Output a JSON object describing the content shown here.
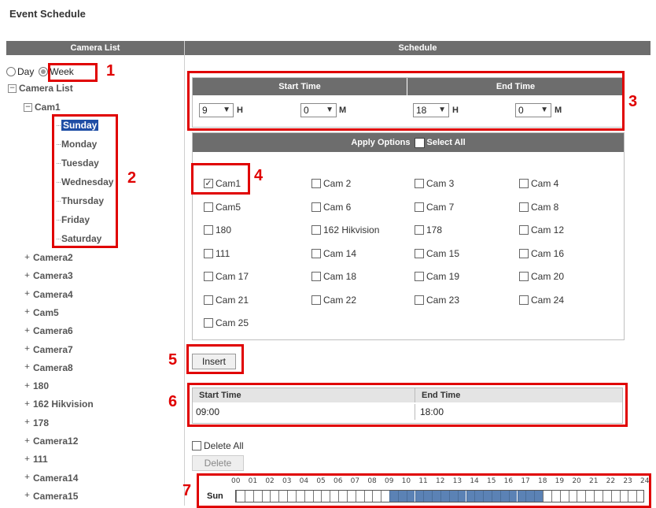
{
  "page_title": "Event Schedule",
  "left": {
    "header": "Camera List",
    "mode_day": "Day",
    "mode_week": "Week",
    "root": "Camera List",
    "cam1": "Cam1",
    "days": [
      "Sunday",
      "Monday",
      "Tuesday",
      "Wednesday",
      "Thursday",
      "Friday",
      "Saturday"
    ],
    "selected_day": "Sunday",
    "cameras": [
      "Camera2",
      "Camera3",
      "Camera4",
      "Cam5",
      "Camera6",
      "Camera7",
      "Camera8",
      "180",
      "162 Hikvision",
      "178",
      "Camera12",
      "111",
      "Camera14",
      "Camera15"
    ]
  },
  "schedule": {
    "header": "Schedule",
    "start_time_label": "Start Time",
    "end_time_label": "End Time",
    "start_hour": "9",
    "start_min": "0",
    "end_hour": "18",
    "end_min": "0",
    "unit_h": "H",
    "unit_m": "M",
    "apply_options": "Apply Options",
    "select_all": "Select All",
    "cams": [
      {
        "label": "Cam1",
        "checked": true
      },
      {
        "label": "Cam 2",
        "checked": false
      },
      {
        "label": "Cam 3",
        "checked": false
      },
      {
        "label": "Cam 4",
        "checked": false
      },
      {
        "label": "Cam5",
        "checked": false
      },
      {
        "label": "Cam 6",
        "checked": false
      },
      {
        "label": "Cam 7",
        "checked": false
      },
      {
        "label": "Cam 8",
        "checked": false
      },
      {
        "label": "180",
        "checked": false
      },
      {
        "label": "162 Hikvision",
        "checked": false
      },
      {
        "label": "178",
        "checked": false
      },
      {
        "label": "Cam 12",
        "checked": false
      },
      {
        "label": "111",
        "checked": false
      },
      {
        "label": "Cam 14",
        "checked": false
      },
      {
        "label": "Cam 15",
        "checked": false
      },
      {
        "label": "Cam 16",
        "checked": false
      },
      {
        "label": "Cam 17",
        "checked": false
      },
      {
        "label": "Cam 18",
        "checked": false
      },
      {
        "label": "Cam 19",
        "checked": false
      },
      {
        "label": "Cam 20",
        "checked": false
      },
      {
        "label": "Cam 21",
        "checked": false
      },
      {
        "label": "Cam 22",
        "checked": false
      },
      {
        "label": "Cam 23",
        "checked": false
      },
      {
        "label": "Cam 24",
        "checked": false
      },
      {
        "label": "Cam 25",
        "checked": false
      }
    ],
    "insert_label": "Insert",
    "table_start": "Start Time",
    "table_end": "End Time",
    "row_start": "09:00",
    "row_end": "18:00",
    "delete_all": "Delete All",
    "delete_label": "Delete",
    "hours": [
      "00",
      "01",
      "02",
      "03",
      "04",
      "05",
      "06",
      "07",
      "08",
      "09",
      "10",
      "11",
      "12",
      "13",
      "14",
      "15",
      "16",
      "17",
      "18",
      "19",
      "20",
      "21",
      "22",
      "23",
      "24"
    ],
    "day_row": "Sun",
    "active_from_hour": 9,
    "active_to_hour": 18
  },
  "annotations": [
    "1",
    "2",
    "3",
    "4",
    "5",
    "6",
    "7"
  ],
  "colors": {
    "annotation": "#e00000",
    "header": "#6d6d6d",
    "timeline_active": "#5b82b5"
  }
}
